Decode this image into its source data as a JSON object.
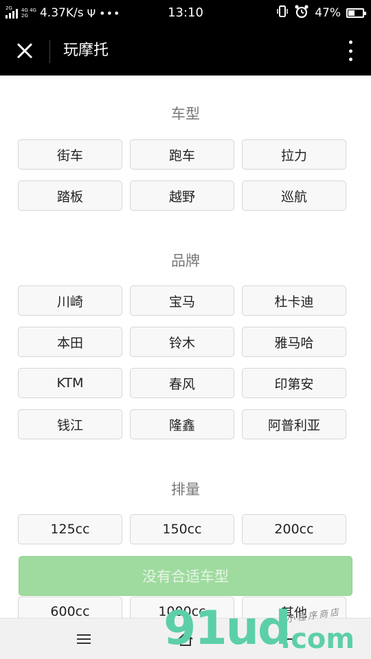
{
  "status_bar": {
    "signal_tag": "2G",
    "net_top": "4G 4G",
    "net_bottom": "2G",
    "speed": "4.37K/s",
    "usb": "Ψ",
    "dots": "•••",
    "time": "13:10",
    "battery_pct": "47%",
    "battery_level": 0.47
  },
  "title_bar": {
    "title": "玩摩托",
    "close_icon": "close-icon",
    "more_icon": "more-vertical-icon"
  },
  "sections": {
    "type": {
      "title": "车型",
      "options": [
        "街车",
        "跑车",
        "拉力",
        "踏板",
        "越野",
        "巡航"
      ]
    },
    "brand": {
      "title": "品牌",
      "options": [
        "川崎",
        "宝马",
        "杜卡迪",
        "本田",
        "铃木",
        "雅马哈",
        "KTM",
        "春风",
        "印第安",
        "钱江",
        "隆鑫",
        "阿普利亚"
      ]
    },
    "displacement": {
      "title": "排量",
      "options": [
        "125cc",
        "150cc",
        "200cc",
        "600cc",
        "1000cc",
        "其他"
      ]
    }
  },
  "no_match_button": "没有合适车型",
  "bottom_nav": {
    "menu_icon": "menu-icon",
    "home_icon": "home-icon",
    "back_icon": "back-arrow-icon"
  },
  "watermark": {
    "main": "91ud",
    "domain": ".com",
    "tagline": "小程序商店"
  },
  "colors": {
    "accent_green": "#9fdb9f",
    "watermark_green": "#5ccfa9",
    "bar_black": "#000000"
  }
}
